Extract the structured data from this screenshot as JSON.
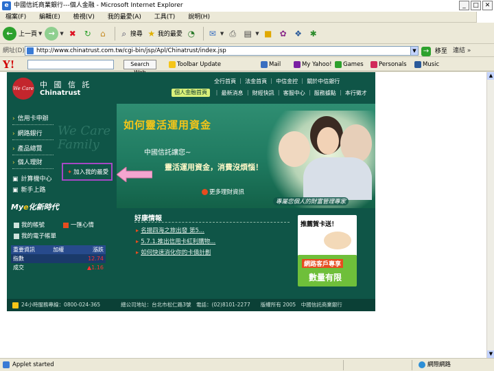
{
  "window": {
    "title": "中國信託商業銀行---個人金融 - Microsoft Internet Explorer",
    "minimize": "_",
    "maximize": "□",
    "close": "✕"
  },
  "menubar": [
    "檔案(F)",
    "編輯(E)",
    "檢視(V)",
    "我的最愛(A)",
    "工具(T)",
    "說明(H)"
  ],
  "toolbar": {
    "back": "上一頁",
    "search": "搜尋",
    "favorites": "我的最愛"
  },
  "address": {
    "label": "網址(D)",
    "url": "http://www.chinatrust.com.tw/cgi-bin/jsp/Apl/Chinatrust/index.jsp",
    "go": "移至",
    "links": "連結"
  },
  "yahoo": {
    "logo": "Y!",
    "search_web": "Search Web",
    "items": [
      "Toolbar Update",
      "Mail",
      "My Yahoo!",
      "Games",
      "Personals",
      "Music"
    ]
  },
  "site": {
    "logo_badge": "We Care",
    "name_zh": "中 國 信 託",
    "name_en": "Chinatrust",
    "top_nav": "全行首頁 ｜ 法金首頁 ｜ 中信金控 ｜ 關於中信銀行",
    "home_btn": "個人金融首頁",
    "sub_nav": "｜ 最新消息 ｜ 財經快訊 ｜ 客服中心 ｜ 服務據點 ｜ 本行徵才",
    "left_menu": [
      "信用卡申辦",
      "網路銀行",
      "產品總覽",
      "個人理財"
    ],
    "watermark": "We Care Family",
    "tools": [
      "計算機中心",
      "新手上路"
    ],
    "callout": "加入我的最愛",
    "banner": {
      "title": "如何靈活運用資金",
      "line1": "中國信託讓您~",
      "line2": "靈活運用資金，消費沒煩惱！",
      "more": "更多理財資訊",
      "tag": "專屬您個人的財富管理專家"
    },
    "mye": {
      "title_prefix": "My",
      "title_e": "e",
      "title_suffix": "化新時代",
      "items": [
        "我的帳號",
        "一匯心情",
        "我的電子帳單"
      ],
      "table_headers": [
        "重要資訊",
        "加權",
        "漲跌"
      ],
      "rows": [
        {
          "name": "指數",
          "value": "",
          "change": "12.74"
        },
        {
          "name": "成交",
          "value": "",
          "change": "▲1.16"
        }
      ]
    },
    "news": {
      "title": "好康情報",
      "items": [
        "名揚四海之旅出發 第5...",
        "5.7.1.推出信用卡紅利購物...",
        "如何快速消化你的卡債計劃"
      ]
    },
    "ad1": "推薦賀卡送！",
    "ad2_line1": "網路客戶專享",
    "ad2_line2": "數量有限",
    "footer": "24小時服務專線：0800-024-365　　　　總公司地址：台北市松仁路3號　電話：(02)8101-2277　　版權所有 2005　中國信託商業銀行"
  },
  "status": {
    "text": "Applet started",
    "zone": "網際網路"
  }
}
